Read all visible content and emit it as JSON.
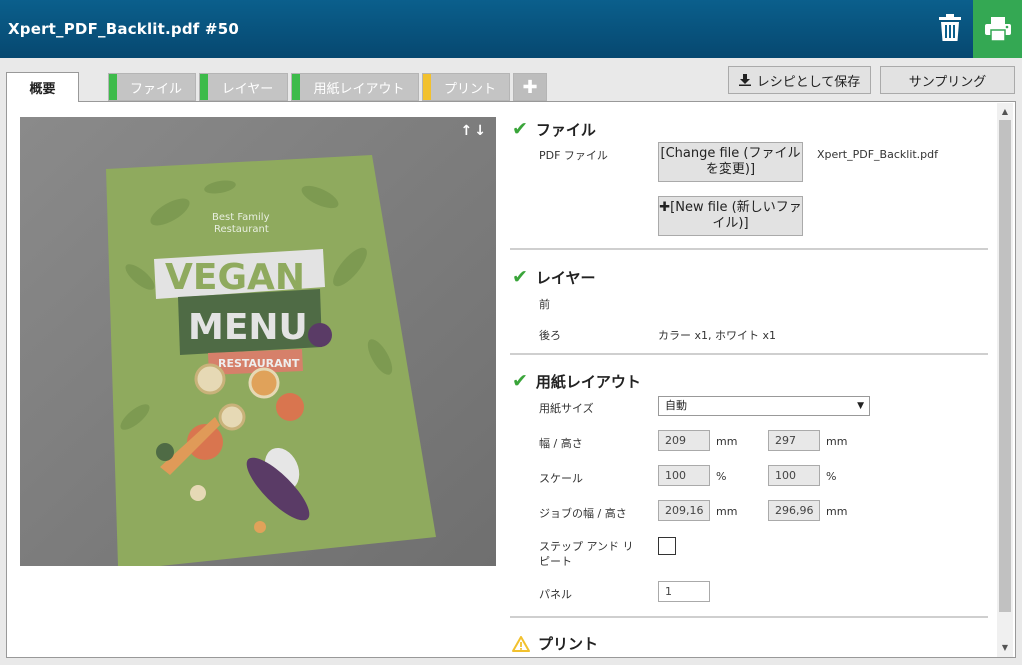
{
  "header": {
    "title": "Xpert_PDF_Backlit.pdf #50"
  },
  "tabs": [
    {
      "label": "概要"
    },
    {
      "label": "ファイル"
    },
    {
      "label": "レイヤー"
    },
    {
      "label": "用紙レイアウト"
    },
    {
      "label": "プリント"
    }
  ],
  "toolbar": {
    "save_recipe_label": "レシピとして保存",
    "sampling_label": "サンプリング"
  },
  "preview": {
    "arrows": "↑↓",
    "artwork": {
      "line1": "Best Family",
      "line2": "Restaurant",
      "word1": "VEGAN",
      "word2": "MENU",
      "ribbon": "RESTAURANT"
    }
  },
  "file": {
    "title": "ファイル",
    "pdf_label": "PDF ファイル",
    "change_button": "[Change file (ファイルを変更)]",
    "new_button": "[New file (新しいファイル)]",
    "filename": "Xpert_PDF_Backlit.pdf"
  },
  "layers": {
    "title": "レイヤー",
    "front_label": "前",
    "back_label": "後ろ",
    "back_value": "カラー x1, ホワイト x1"
  },
  "layout": {
    "title": "用紙レイアウト",
    "paper_size_label": "用紙サイズ",
    "paper_size_value": "自動",
    "size_label": "幅 / 高さ",
    "width": "209",
    "height": "297",
    "scale_label": "スケール",
    "scale_x": "100",
    "scale_y": "100",
    "job_size_label": "ジョブの幅 / 高さ",
    "job_width": "209,16",
    "job_height": "296,96",
    "step_repeat_label": "ステップ アンド リピート",
    "panel_label": "パネル",
    "panel_value": "1",
    "unit_mm": "mm",
    "unit_pct": "%"
  },
  "print": {
    "title": "プリント"
  },
  "colors": {
    "header": "#0b5f8c",
    "print_button": "#34a853",
    "tab_green": "#3dbb4a",
    "tab_yellow": "#f2c12e",
    "check": "#3aa53a",
    "warning": "#f2c12e"
  }
}
